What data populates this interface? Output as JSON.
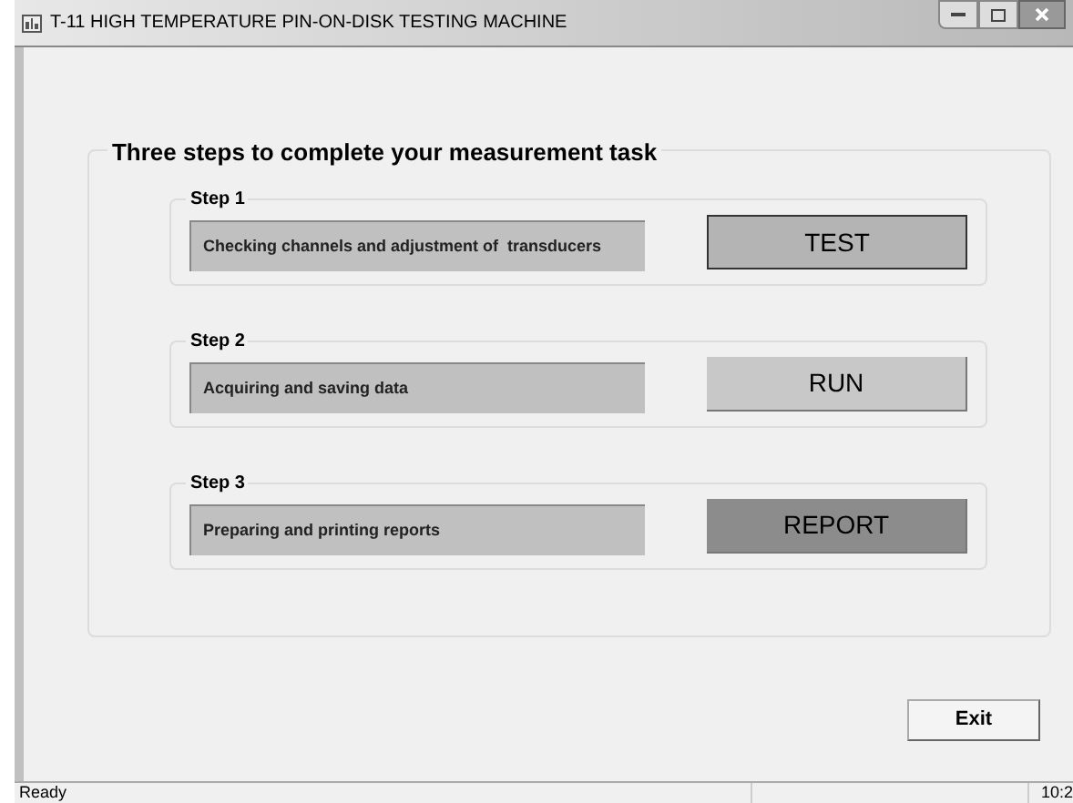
{
  "window": {
    "title": "T-11 HIGH TEMPERATURE PIN-ON-DISK TESTING MACHINE"
  },
  "group": {
    "title": "Three steps to complete your measurement task"
  },
  "steps": [
    {
      "label": "Step 1",
      "description": "Checking channels and adjustment of  transducers",
      "button": "TEST",
      "color": "#b4b4b4",
      "focused": true
    },
    {
      "label": "Step 2",
      "description": "Acquiring and saving data",
      "button": "RUN",
      "color": "#c8c8c8",
      "focused": false
    },
    {
      "label": "Step 3",
      "description": "Preparing and printing reports",
      "button": "REPORT",
      "color": "#8c8c8c",
      "focused": false
    }
  ],
  "exit_button": "Exit",
  "status_bar": {
    "message": "Ready",
    "time": "10:2"
  }
}
